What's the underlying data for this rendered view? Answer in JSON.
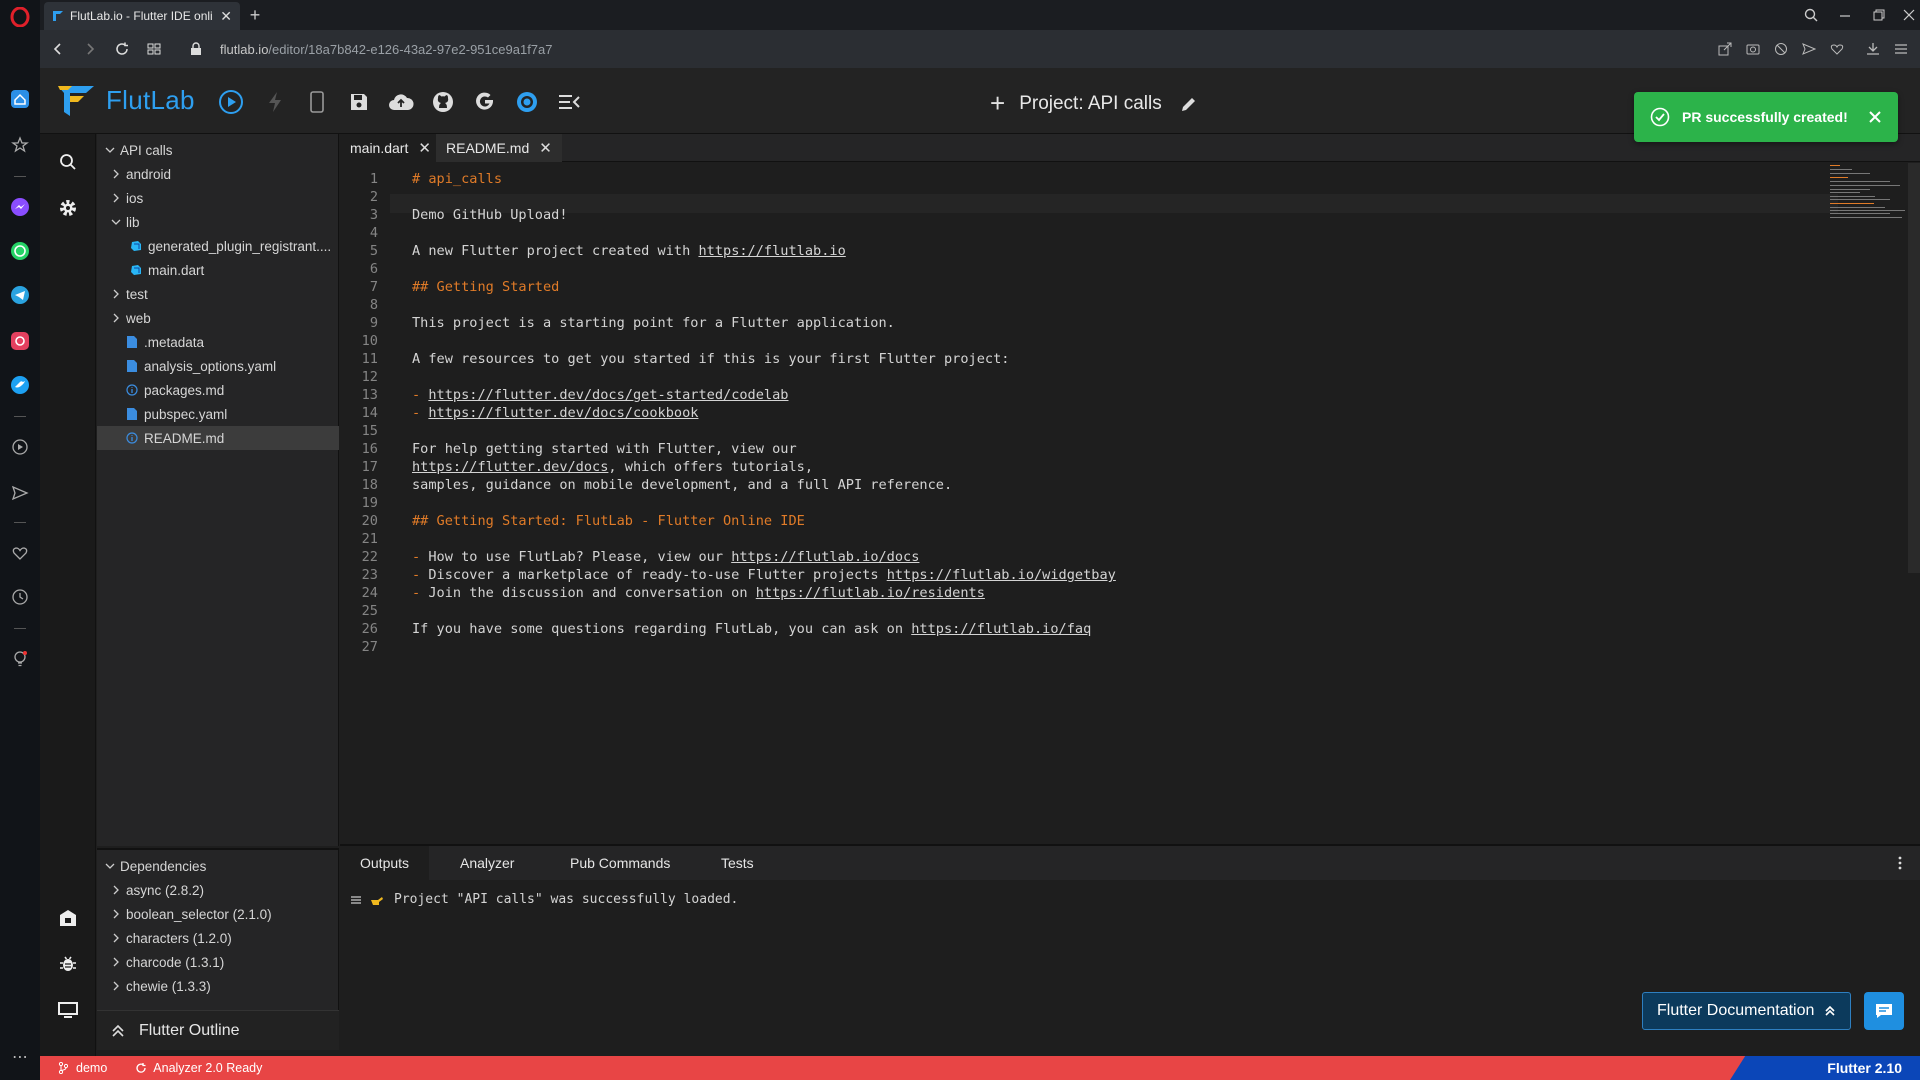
{
  "browser": {
    "tab_title": "FlutLab.io - Flutter IDE onli",
    "url_host": "flutlab.io",
    "url_path": "/editor/18a7b842-e126-43a2-97e2-951ce9a1f7a7"
  },
  "app": {
    "logo_text": "FlutLab",
    "project_title": "Project: API calls",
    "toast_message": "PR successfully created!"
  },
  "file_tree": {
    "root": "API calls",
    "items": [
      {
        "label": "android"
      },
      {
        "label": "ios"
      },
      {
        "label": "lib"
      },
      {
        "label": "generated_plugin_registrant...."
      },
      {
        "label": "main.dart"
      },
      {
        "label": "test"
      },
      {
        "label": "web"
      },
      {
        "label": ".metadata"
      },
      {
        "label": "analysis_options.yaml"
      },
      {
        "label": "packages.md"
      },
      {
        "label": "pubspec.yaml"
      },
      {
        "label": "README.md"
      }
    ]
  },
  "dependencies": {
    "title": "Dependencies",
    "items": [
      {
        "label": "async (2.8.2)"
      },
      {
        "label": "boolean_selector (2.1.0)"
      },
      {
        "label": "characters (1.2.0)"
      },
      {
        "label": "charcode (1.3.1)"
      },
      {
        "label": "chewie (1.3.3)"
      }
    ],
    "outline_label": "Flutter Outline"
  },
  "editor": {
    "tabs": [
      {
        "label": "main.dart"
      },
      {
        "label": "README.md"
      }
    ],
    "lines": [
      {
        "n": "1",
        "text": "# api_calls"
      },
      {
        "n": "2",
        "text": ""
      },
      {
        "n": "3",
        "text": "Demo GitHub Upload!"
      },
      {
        "n": "4",
        "text": ""
      },
      {
        "n": "5",
        "pre": "A new Flutter project created with ",
        "link": "https://flutlab.io"
      },
      {
        "n": "6",
        "text": ""
      },
      {
        "n": "7",
        "text": "## Getting Started"
      },
      {
        "n": "8",
        "text": ""
      },
      {
        "n": "9",
        "text": "This project is a starting point for a Flutter application."
      },
      {
        "n": "10",
        "text": ""
      },
      {
        "n": "11",
        "text": "A few resources to get you started if this is your first Flutter project:"
      },
      {
        "n": "12",
        "text": ""
      },
      {
        "n": "13",
        "link": "https://flutter.dev/docs/get-started/codelab"
      },
      {
        "n": "14",
        "link": "https://flutter.dev/docs/cookbook"
      },
      {
        "n": "15",
        "text": ""
      },
      {
        "n": "16",
        "text": "For help getting started with Flutter, view our"
      },
      {
        "n": "17",
        "post": ", which offers tutorials,",
        "link": "https://flutter.dev/docs"
      },
      {
        "n": "18",
        "text": "samples, guidance on mobile development, and a full API reference."
      },
      {
        "n": "19",
        "text": ""
      },
      {
        "n": "20",
        "text": "## Getting Started: FlutLab - Flutter Online IDE"
      },
      {
        "n": "21",
        "text": ""
      },
      {
        "n": "22",
        "pre": " How to use FlutLab? Please, view our ",
        "link": "https://flutlab.io/docs"
      },
      {
        "n": "23",
        "pre": " Discover a marketplace of ready-to-use Flutter projects ",
        "link": "https://flutlab.io/widgetbay"
      },
      {
        "n": "24",
        "pre": " Join the discussion and conversation on ",
        "link": "https://flutlab.io/residents"
      },
      {
        "n": "25",
        "text": ""
      },
      {
        "n": "26",
        "pre": "If you have some questions regarding FlutLab, you can ask on ",
        "link": "https://flutlab.io/faq"
      },
      {
        "n": "27",
        "text": ""
      }
    ]
  },
  "bottom_panel": {
    "tabs": [
      {
        "label": "Outputs"
      },
      {
        "label": "Analyzer"
      },
      {
        "label": "Pub Commands"
      },
      {
        "label": "Tests"
      }
    ],
    "output": "Project \"API calls\" was successfully loaded.",
    "flutter_doc_label": "Flutter Documentation"
  },
  "statusbar": {
    "branch": "demo",
    "analyzer": "Analyzer 2.0 Ready",
    "flutter_version": "Flutter 2.10"
  }
}
